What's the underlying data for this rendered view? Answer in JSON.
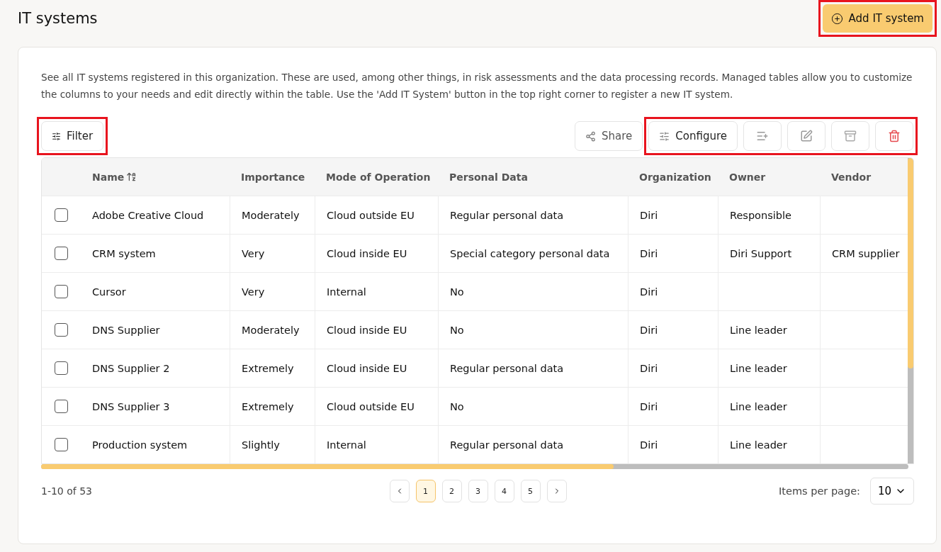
{
  "page": {
    "title": "IT systems",
    "add_button": {
      "label": "Add IT system",
      "highlighted": true
    }
  },
  "description": "See all IT systems registered in this organization. These are used, among other things, in risk assessments and the data processing records. Managed tables allow you to customize the columns to your needs and edit directly within the table. Use the 'Add IT System' button in the top right corner to register a new IT system.",
  "toolbar": {
    "filter": {
      "label": "Filter",
      "highlighted": true
    },
    "share": {
      "label": "Share"
    },
    "actions_highlighted": true,
    "configure": {
      "label": "Configure"
    }
  },
  "table": {
    "columns": [
      {
        "label": "Name",
        "sorted": true
      },
      {
        "label": "Importance",
        "sorted": false
      },
      {
        "label": "Mode of Operation",
        "sorted": false
      },
      {
        "label": "Personal Data",
        "sorted": false
      },
      {
        "label": "Organization",
        "sorted": false
      },
      {
        "label": "Owner",
        "sorted": false
      },
      {
        "label": "Vendor",
        "sorted": false
      }
    ],
    "rows": [
      {
        "selected": false,
        "cells": [
          "Adobe Creative Cloud",
          "Moderately",
          "Cloud outside EU",
          "Regular personal data",
          "Diri",
          "Responsible",
          ""
        ]
      },
      {
        "selected": false,
        "cells": [
          "CRM system",
          "Very",
          "Cloud inside EU",
          "Special category personal data",
          "Diri",
          "Diri Support",
          "CRM supplier"
        ]
      },
      {
        "selected": false,
        "cells": [
          "Cursor",
          "Very",
          "Internal",
          "No",
          "Diri",
          "",
          ""
        ]
      },
      {
        "selected": false,
        "cells": [
          "DNS Supplier",
          "Moderately",
          "Cloud inside EU",
          "No",
          "Diri",
          "Line leader",
          ""
        ]
      },
      {
        "selected": false,
        "cells": [
          "DNS Supplier 2",
          "Extremely",
          "Cloud inside EU",
          "Regular personal data",
          "Diri",
          "Line leader",
          ""
        ]
      },
      {
        "selected": false,
        "cells": [
          "DNS Supplier 3",
          "Extremely",
          "Cloud outside EU",
          "No",
          "Diri",
          "Line leader",
          ""
        ]
      },
      {
        "selected": false,
        "cells": [
          "Production system",
          "Slightly",
          "Internal",
          "Regular personal data",
          "Diri",
          "Line leader",
          ""
        ]
      }
    ]
  },
  "footer": {
    "range": "1-10 of 53",
    "pages": [
      {
        "label": "1",
        "selected": true
      },
      {
        "label": "2",
        "selected": false
      },
      {
        "label": "3",
        "selected": false
      },
      {
        "label": "4",
        "selected": false
      },
      {
        "label": "5",
        "selected": false
      }
    ],
    "items_per_page_label": "Items per page:",
    "items_per_page": "10"
  }
}
